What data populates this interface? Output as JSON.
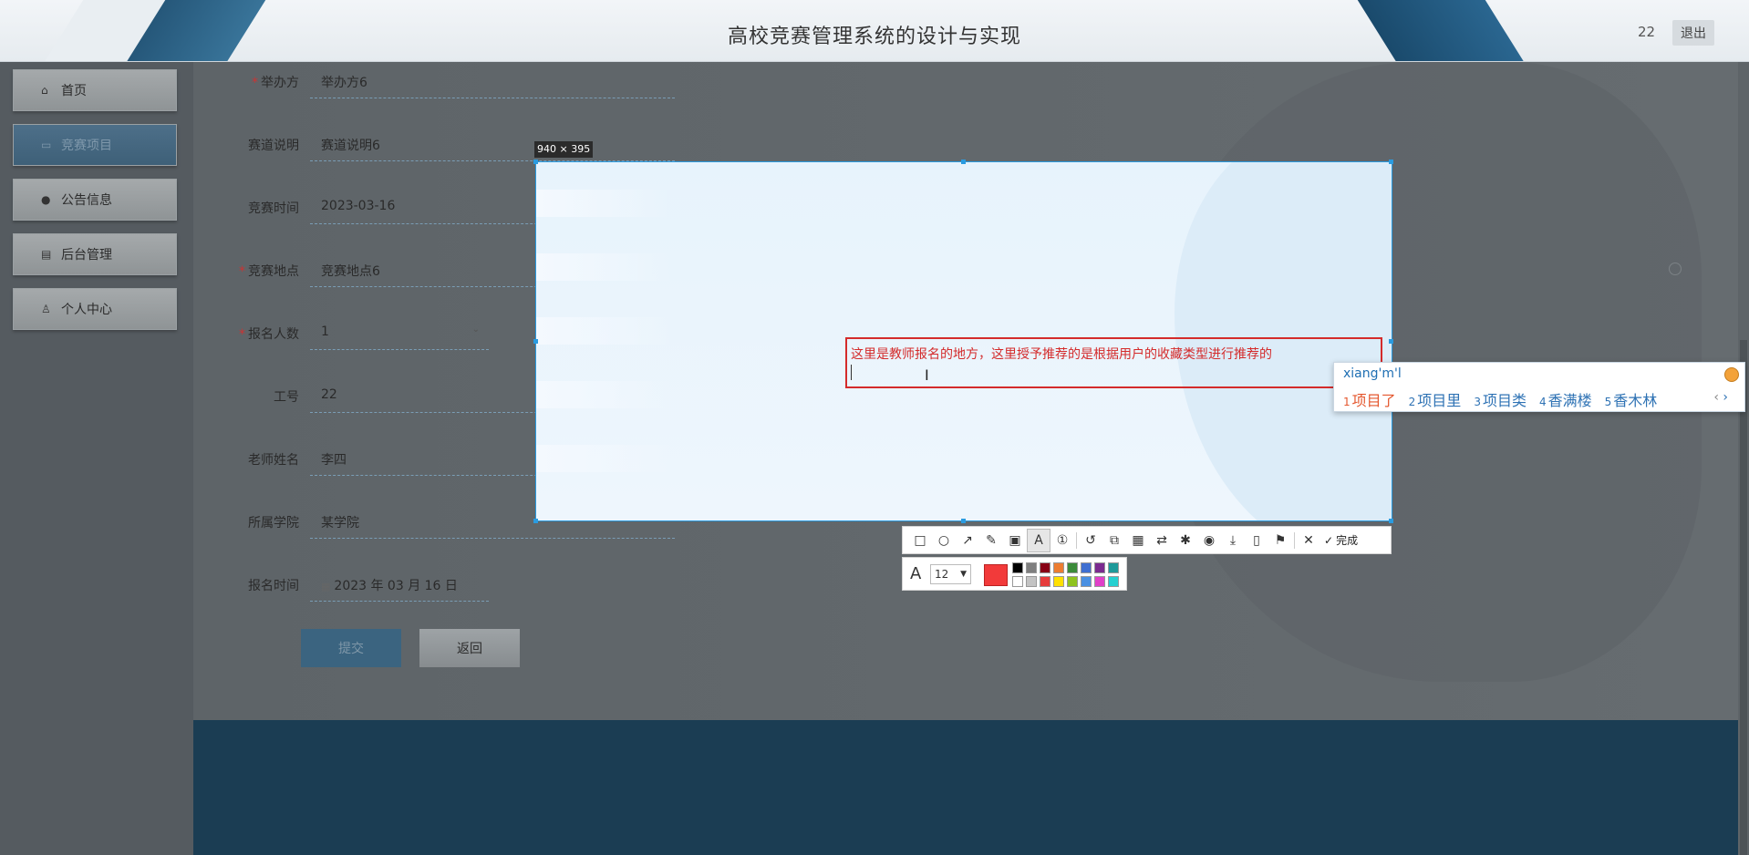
{
  "header": {
    "title": "高校竞赛管理系统的设计与实现",
    "user": "22",
    "logout_label": "退出"
  },
  "sidebar": {
    "items": [
      {
        "label": "首页",
        "icon": "home-icon",
        "glyph": "⌂"
      },
      {
        "label": "竞赛项目",
        "icon": "briefcase-icon",
        "glyph": "▭",
        "active": true
      },
      {
        "label": "公告信息",
        "icon": "info-icon",
        "glyph": "●"
      },
      {
        "label": "后台管理",
        "icon": "calendar-icon",
        "glyph": "▤"
      },
      {
        "label": "个人中心",
        "icon": "user-icon",
        "glyph": "♙"
      }
    ]
  },
  "form": {
    "organizer": {
      "label": "举办方",
      "value": "举办方6",
      "required": true
    },
    "track_desc": {
      "label": "赛道说明",
      "value": "赛道说明6"
    },
    "comp_time": {
      "label": "竞赛时间",
      "value": "2023-03-16"
    },
    "comp_location": {
      "label": "竞赛地点",
      "value": "竞赛地点6",
      "required": true
    },
    "signup_count": {
      "label": "报名人数",
      "value": "1",
      "required": true
    },
    "staff_id": {
      "label": "工号",
      "value": "22"
    },
    "teacher_name": {
      "label": "老师姓名",
      "value": "李四"
    },
    "college": {
      "label": "所属学院",
      "value": "某学院"
    },
    "signup_time": {
      "label": "报名时间",
      "value": "2023 年 03 月 16 日"
    },
    "submit_label": "提交",
    "back_label": "返回"
  },
  "capture": {
    "size_label": "940 × 395",
    "annotation_text": "这里是教师报名的地方，这里授予推荐的是根据用户的收藏类型进行推荐的",
    "ime": {
      "input": "xiang'm'l",
      "candidates": [
        {
          "num": "1",
          "text": "项目了"
        },
        {
          "num": "2",
          "text": "项目里"
        },
        {
          "num": "3",
          "text": "项目类"
        },
        {
          "num": "4",
          "text": "香满楼"
        },
        {
          "num": "5",
          "text": "香木林"
        }
      ]
    },
    "toolbar": {
      "done_label": "完成"
    },
    "textbar": {
      "font_size": "12",
      "current_color": "#f23a3a",
      "palette": [
        "#000000",
        "#7f7f7f",
        "#880015",
        "#ed7d31",
        "#3c8b3a",
        "#3f6fd1",
        "#7b2a8f",
        "#1e9a9a",
        "#ffffff",
        "#c3c3c3",
        "#e63b3b",
        "#ffe000",
        "#8fc31f",
        "#4a90e2",
        "#e040c8",
        "#25d0d0"
      ]
    }
  }
}
